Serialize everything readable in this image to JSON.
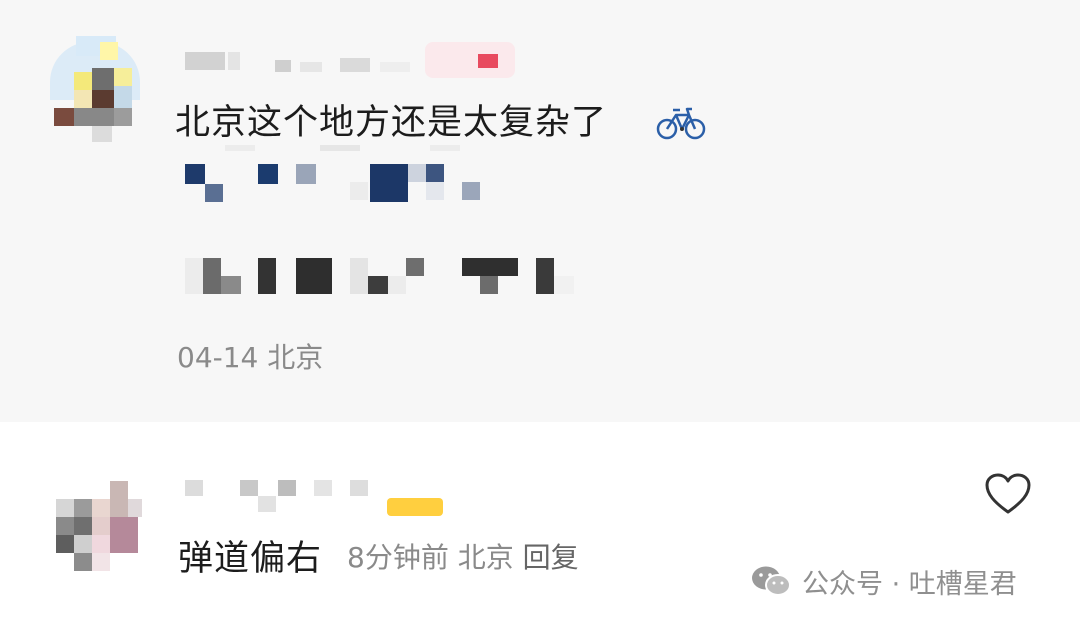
{
  "comments": [
    {
      "text": "北京这个地方还是太复杂了",
      "emoji": "bicycle",
      "date": "04-14",
      "location": "北京"
    },
    {
      "text": "弹道偏右",
      "time": "8分钟前",
      "location": "北京",
      "reply_label": "回复"
    }
  ],
  "watermark": {
    "text": "公众号 · 吐槽星君"
  },
  "icons": {
    "like": "heart-outline-icon",
    "emoji": "bicycle-icon",
    "watermark_logo": "wechat-icon"
  },
  "colors": {
    "comment_text": "#1c1c1c",
    "meta_text": "#8a8a8a",
    "highlight_bg": "#f7f7f7"
  }
}
